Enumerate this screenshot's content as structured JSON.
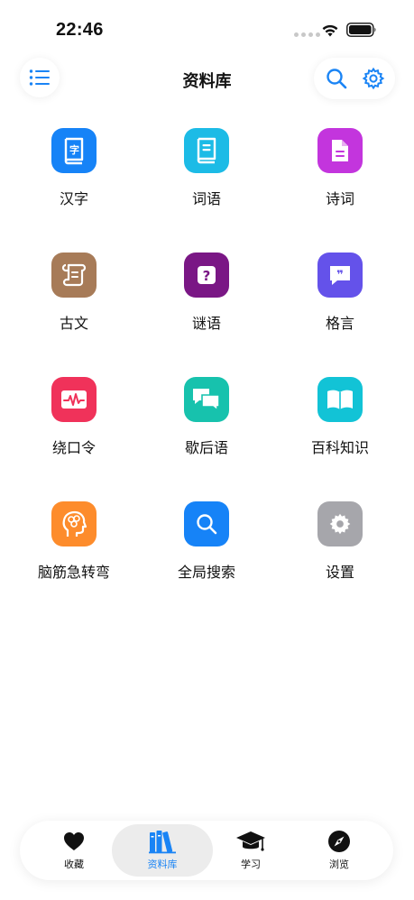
{
  "status_bar": {
    "time": "22:46"
  },
  "nav": {
    "title": "资料库",
    "menu_icon": "list-icon",
    "search_icon": "search-icon",
    "settings_icon": "gear-icon"
  },
  "categories": [
    {
      "label": "汉字",
      "icon": "book-zi-icon",
      "color": "#1683f7"
    },
    {
      "label": "词语",
      "icon": "book-icon",
      "color": "#1cbbe6"
    },
    {
      "label": "诗词",
      "icon": "document-icon",
      "color": "#c335dd"
    },
    {
      "label": "古文",
      "icon": "scroll-icon",
      "color": "#a77b58"
    },
    {
      "label": "谜语",
      "icon": "question-icon",
      "color": "#7a1785"
    },
    {
      "label": "格言",
      "icon": "quote-icon",
      "color": "#6452ea"
    },
    {
      "label": "绕口令",
      "icon": "waveform-icon",
      "color": "#f0325a"
    },
    {
      "label": "歇后语",
      "icon": "chat-bubbles-icon",
      "color": "#17c2ad"
    },
    {
      "label": "百科知识",
      "icon": "open-book-icon",
      "color": "#12c3d6"
    },
    {
      "label": "脑筋急转弯",
      "icon": "brain-head-icon",
      "color": "#fd8c2c"
    },
    {
      "label": "全局搜索",
      "icon": "search-icon",
      "color": "#1683f7"
    },
    {
      "label": "设置",
      "icon": "gear-icon",
      "color": "#a6a6ab"
    }
  ],
  "tab_bar": {
    "active_color": "#1a84f5",
    "items": [
      {
        "label": "收藏",
        "icon": "heart-icon",
        "active": false
      },
      {
        "label": "资料库",
        "icon": "books-icon",
        "active": true
      },
      {
        "label": "学习",
        "icon": "graduation-cap-icon",
        "active": false
      },
      {
        "label": "浏览",
        "icon": "compass-icon",
        "active": false
      }
    ]
  }
}
